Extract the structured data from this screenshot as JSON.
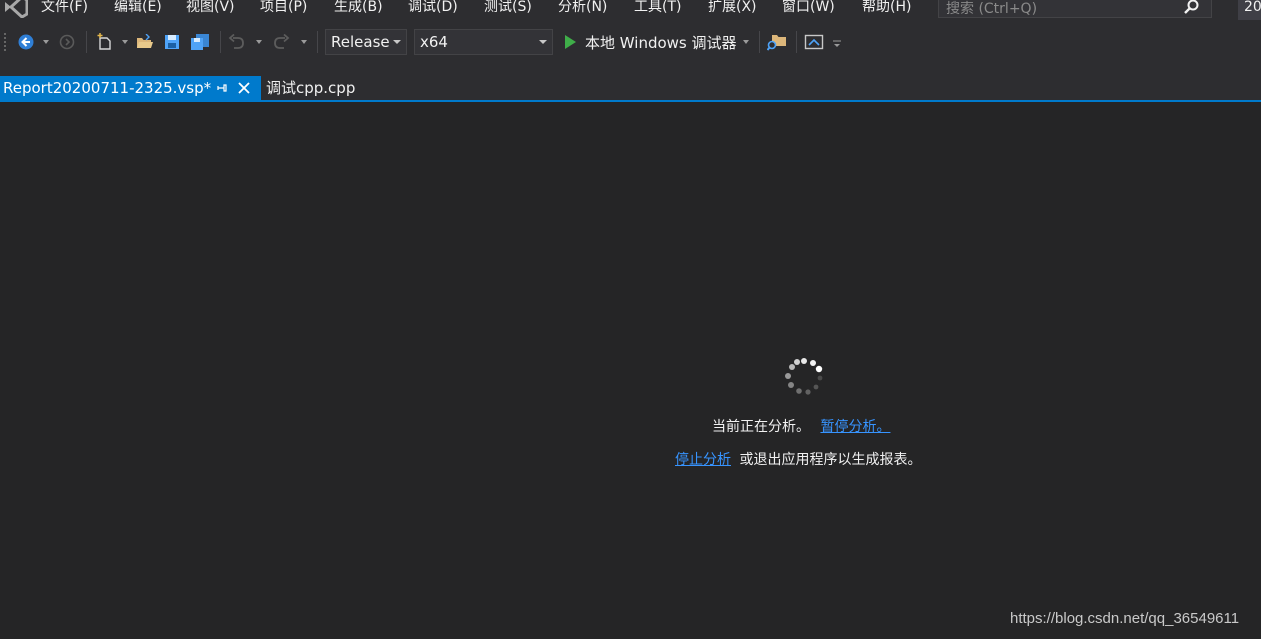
{
  "menubar": {
    "items": [
      {
        "label": "文件(F)"
      },
      {
        "label": "编辑(E)"
      },
      {
        "label": "视图(V)"
      },
      {
        "label": "项目(P)"
      },
      {
        "label": "生成(B)"
      },
      {
        "label": "调试(D)"
      },
      {
        "label": "测试(S)"
      },
      {
        "label": "分析(N)"
      },
      {
        "label": "工具(T)"
      },
      {
        "label": "扩展(X)"
      },
      {
        "label": "窗口(W)"
      },
      {
        "label": "帮助(H)"
      }
    ],
    "search_placeholder": "搜索 (Ctrl+Q)",
    "search_icon": "search-icon",
    "year_badge": "20"
  },
  "toolbar": {
    "configuration": "Release",
    "platform": "x64",
    "run_label": "本地 Windows 调试器"
  },
  "tabs": {
    "active": "Report20200711-2325.vsp*",
    "inactive": "调试cpp.cpp"
  },
  "status": {
    "line1_text": "当前正在分析。",
    "pause_link": "暂停分析。",
    "stop_link": "停止分析",
    "line2_text": "或退出应用程序以生成报表。"
  },
  "watermark": "https://blog.csdn.net/qq_36549611",
  "colors": {
    "accent": "#007acc",
    "link": "#3794ff",
    "background": "#252526",
    "chrome": "#2d2d30"
  }
}
